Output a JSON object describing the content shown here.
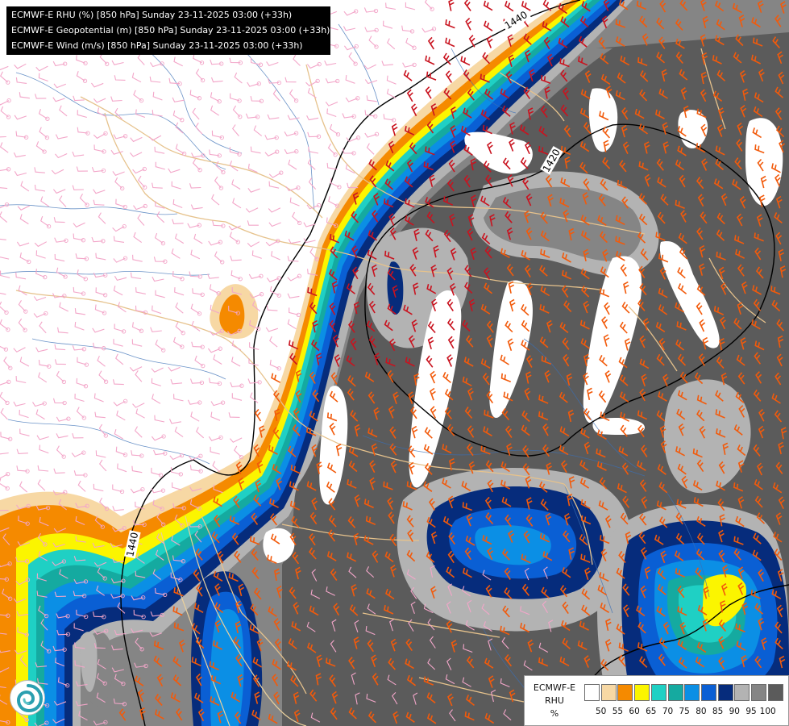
{
  "titles": [
    "ECMWF-E RHU (%) [850 hPa] Sunday 23-11-2025 03:00 (+33h)",
    "ECMWF-E Geopotential (m) [850 hPa] Sunday 23-11-2025 03:00 (+33h)",
    "ECMWF-E Wind (m/s) [850 hPa] Sunday 23-11-2025 03:00 (+33h)"
  ],
  "contour_labels": [
    "1440",
    "1420",
    "1440"
  ],
  "legend": {
    "title_lines": [
      "ECMWF-E",
      "RHU",
      "%"
    ],
    "colors": [
      "#ffffff",
      "#f7d8a4",
      "#f58a00",
      "#fbf500",
      "#1fd0c4",
      "#15aaa0",
      "#0b8fe5",
      "#0a5fd4",
      "#062c7c",
      "#b3b3b3",
      "#858585",
      "#5b5b5b"
    ],
    "ticks": [
      "50",
      "55",
      "60",
      "65",
      "70",
      "75",
      "80",
      "85",
      "90",
      "95",
      "100"
    ]
  },
  "logo": {
    "icon": "ecmwf-logo-icon"
  },
  "wind_barb_colors": [
    "#f3a6c9",
    "#f25a0b",
    "#c9131f"
  ]
}
